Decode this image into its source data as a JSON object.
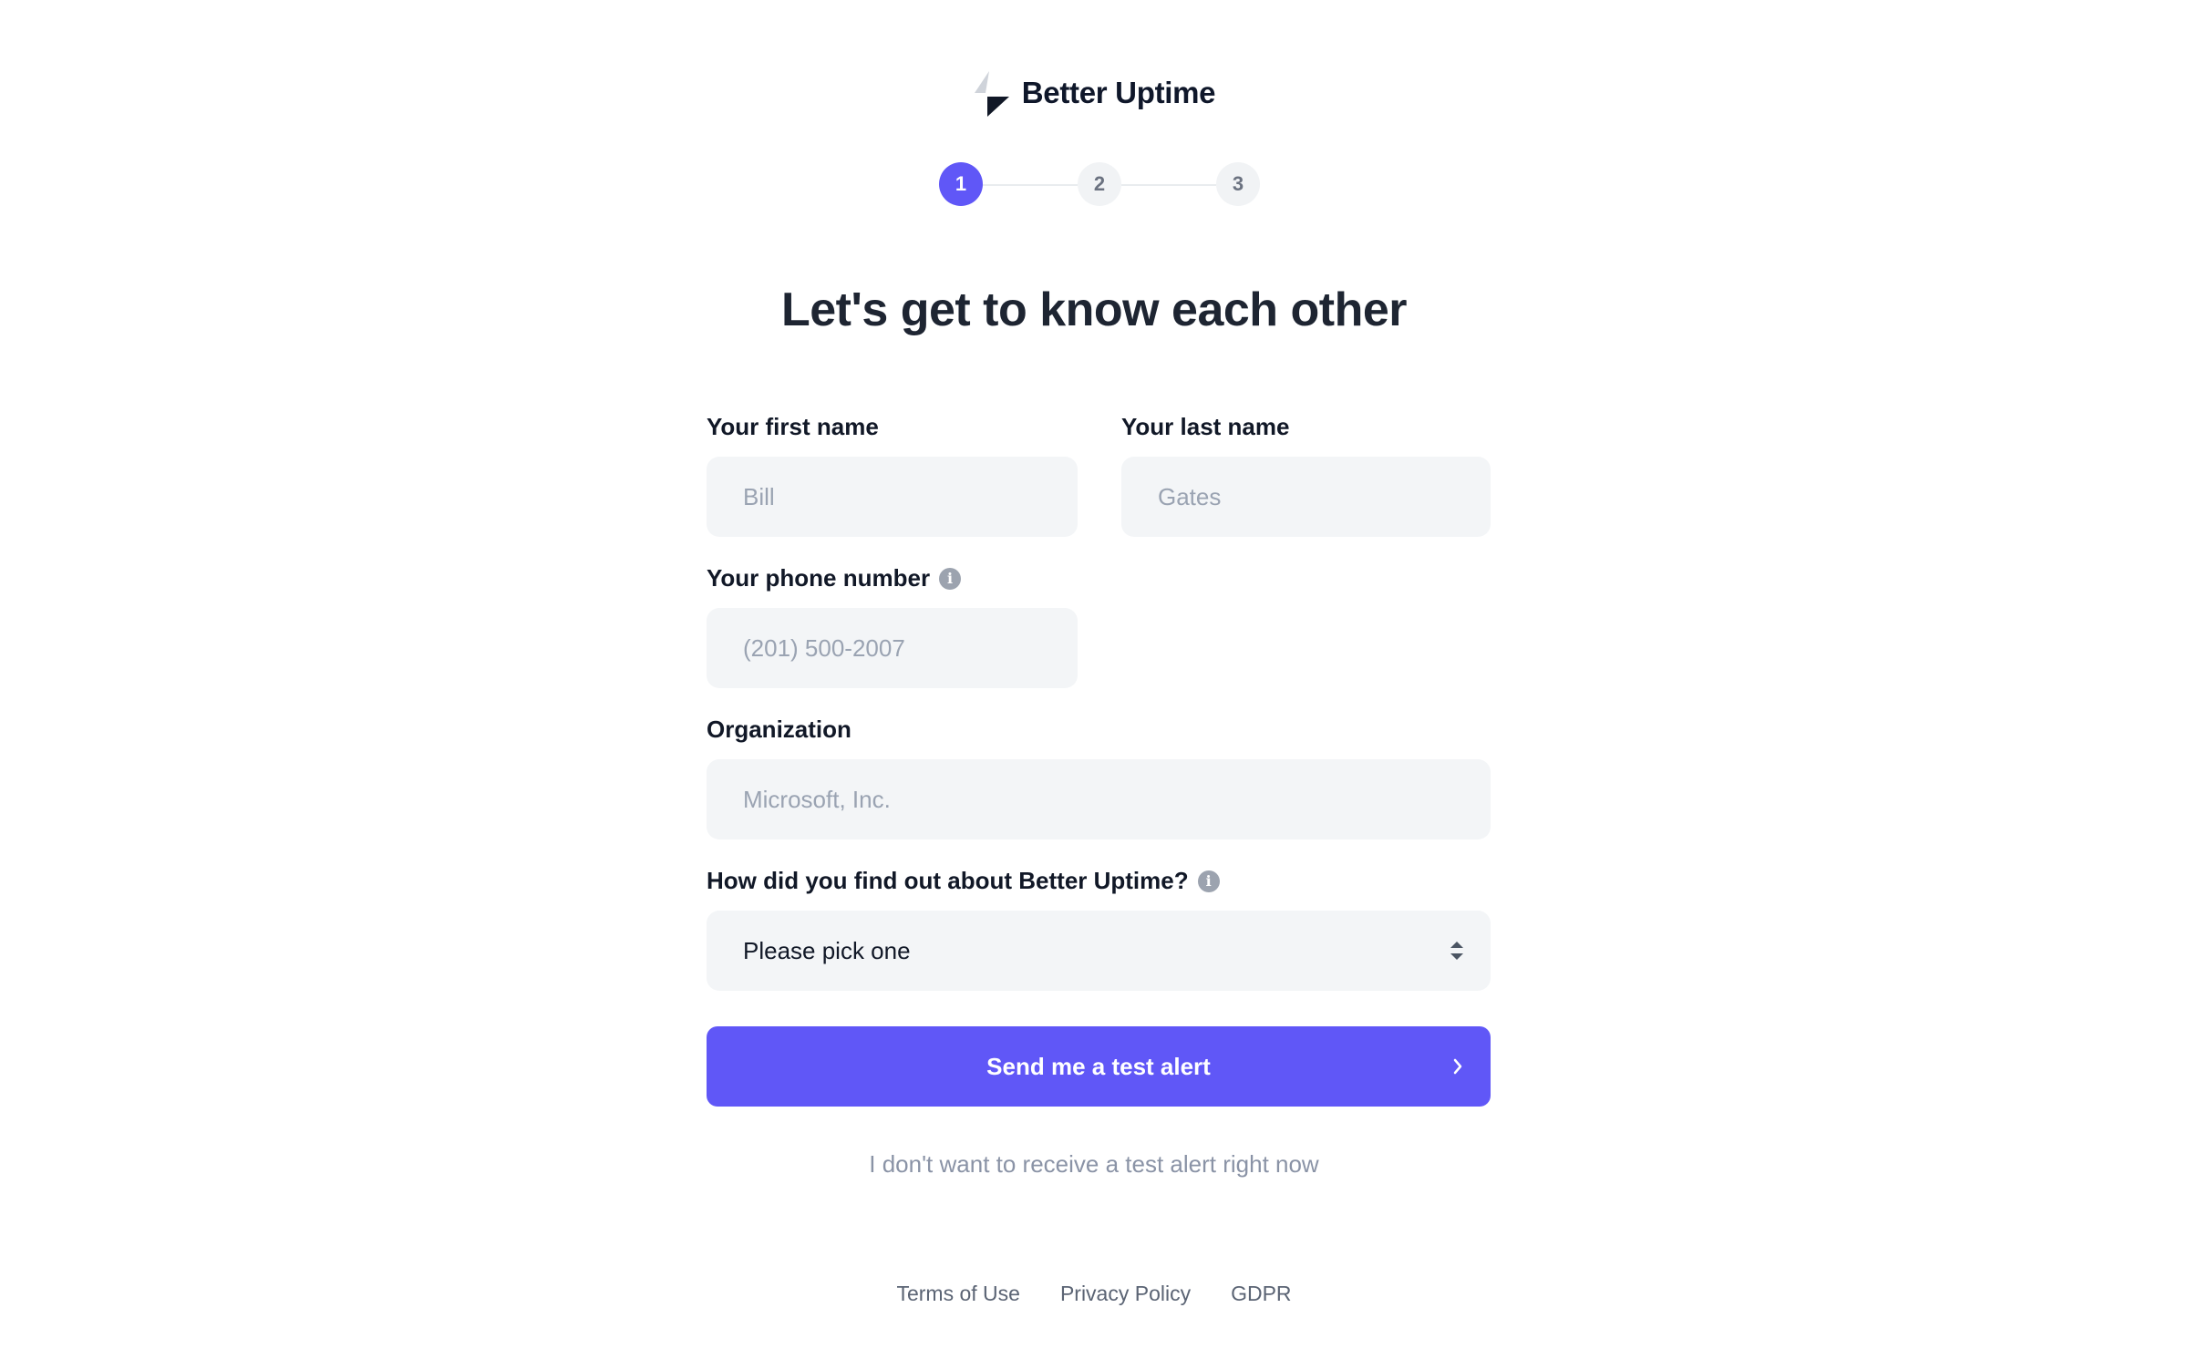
{
  "brand": {
    "name": "Better Uptime"
  },
  "stepper": {
    "steps": [
      "1",
      "2",
      "3"
    ],
    "active_step": 1,
    "colors": {
      "active": "#6057f7",
      "inactive": "#f1f3f5"
    }
  },
  "form": {
    "title": "Let's get to know each other",
    "first_name": {
      "label": "Your first name",
      "placeholder": "Bill",
      "value": ""
    },
    "last_name": {
      "label": "Your last name",
      "placeholder": "Gates",
      "value": ""
    },
    "phone": {
      "label": "Your phone number",
      "placeholder": "(201) 500-2007",
      "value": "",
      "icon": "info-icon"
    },
    "organization": {
      "label": "Organization",
      "placeholder": "Microsoft, Inc.",
      "value": ""
    },
    "referral": {
      "label": "How did you find out about Better Uptime?",
      "selected": "Please pick one",
      "icon": "info-icon"
    },
    "submit_label": "Send me a test alert",
    "skip_label": "I don't want to receive a test alert right now"
  },
  "footer": {
    "links": [
      "Terms of Use",
      "Privacy Policy",
      "GDPR"
    ]
  },
  "colors": {
    "accent": "#6057f7",
    "field_background": "#f3f5f7"
  }
}
